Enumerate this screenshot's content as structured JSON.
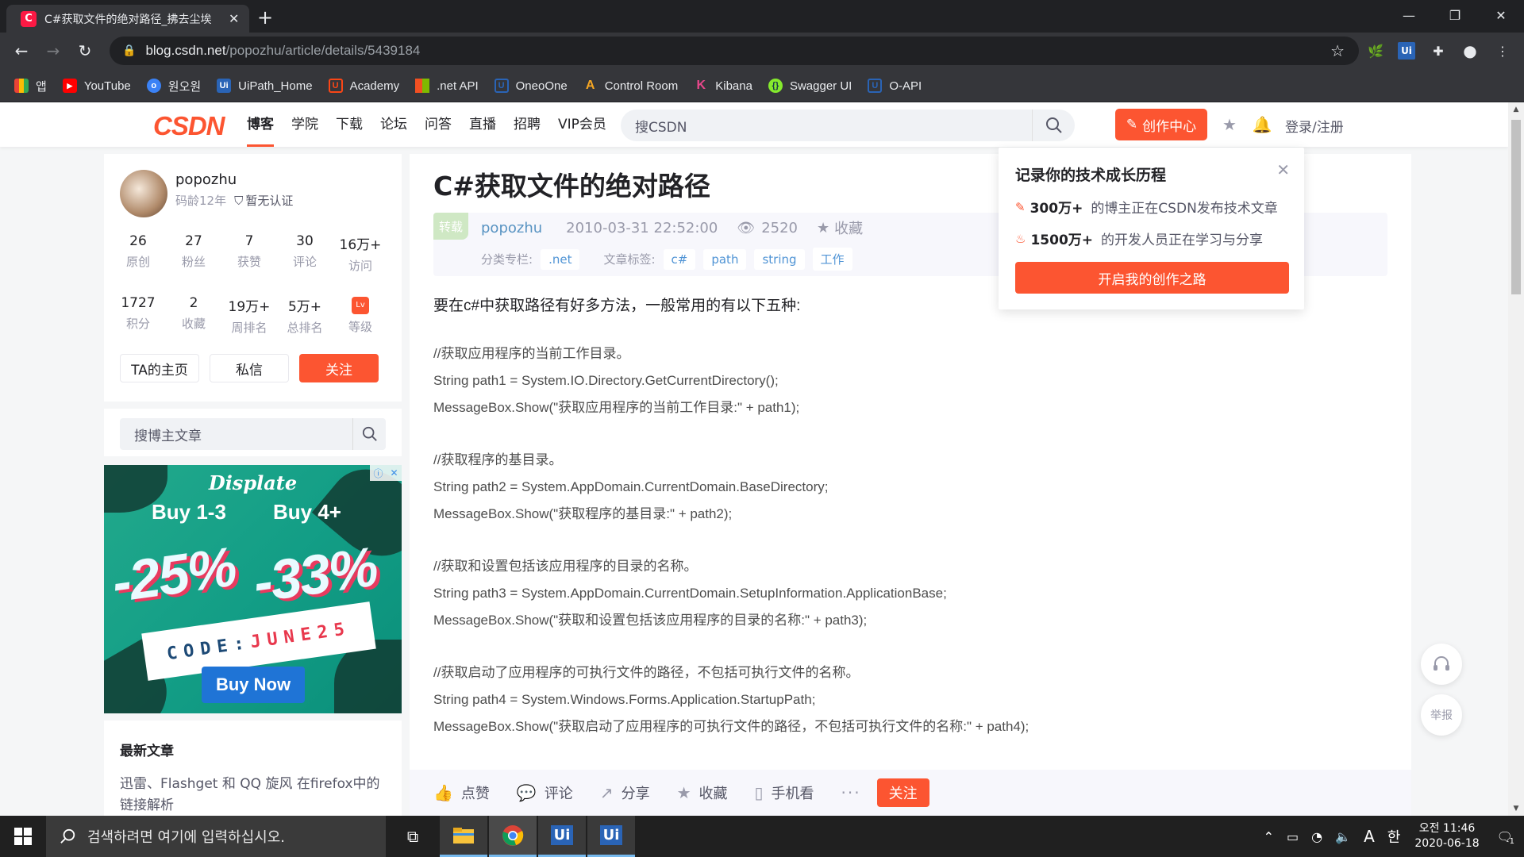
{
  "browser": {
    "tab_title": "C#获取文件的绝对路径_拂去尘埃",
    "favicon_letter": "C",
    "url_host": "blog.csdn.net",
    "url_path": "/popozhu/article/details/5439184",
    "bookmarks": [
      {
        "label": "앱",
        "icon": "apps-icon",
        "color": "#4285f4"
      },
      {
        "label": "YouTube",
        "icon": "youtube-icon",
        "color": "#ff0000"
      },
      {
        "label": "원오원",
        "icon": "wonone-icon",
        "color": "#3b82f6"
      },
      {
        "label": "UiPath_Home",
        "icon": "uipath-icon",
        "color": "#2a64b6"
      },
      {
        "label": "Academy",
        "icon": "uipath-academy-icon",
        "color": "#fa4616"
      },
      {
        "label": ".net API",
        "icon": "microsoft-icon",
        "color": "#f25022"
      },
      {
        "label": "OneoOne",
        "icon": "uipath-outline-icon",
        "color": "#2a64b6"
      },
      {
        "label": "Control Room",
        "icon": "automation-anywhere-icon",
        "color": "#f5a623"
      },
      {
        "label": "Kibana",
        "icon": "kibana-icon",
        "color": "#e8478b"
      },
      {
        "label": "Swagger UI",
        "icon": "swagger-icon",
        "color": "#85ea2d"
      },
      {
        "label": "O-API",
        "icon": "uipath-outline-icon",
        "color": "#2a64b6"
      }
    ]
  },
  "header": {
    "logo": "CSDN",
    "nav": [
      "博客",
      "学院",
      "下载",
      "论坛",
      "问答",
      "直播",
      "招聘",
      "VIP会员"
    ],
    "active_nav": "博客",
    "search_placeholder": "搜CSDN",
    "create_label": "创作中心",
    "login_label": "登录/注册"
  },
  "profile": {
    "name": "popozhu",
    "years": "码龄12年",
    "verify": "暂无认证",
    "stats_row1": [
      {
        "num": "26",
        "label": "原创"
      },
      {
        "num": "27",
        "label": "粉丝"
      },
      {
        "num": "7",
        "label": "获赞"
      },
      {
        "num": "30",
        "label": "评论"
      },
      {
        "num": "16万+",
        "label": "访问"
      }
    ],
    "stats_row2": [
      {
        "num": "1727",
        "label": "积分"
      },
      {
        "num": "2",
        "label": "收藏"
      },
      {
        "num": "19万+",
        "label": "周排名"
      },
      {
        "num": "5万+",
        "label": "总排名"
      },
      {
        "num": "",
        "label": "等级"
      }
    ],
    "btn_home": "TA的主页",
    "btn_message": "私信",
    "btn_follow": "关注"
  },
  "blog_search": {
    "placeholder": "搜博主文章"
  },
  "ad": {
    "brand": "Displate",
    "buy1": "Buy 1-3",
    "buy2": "Buy 4+",
    "pct1": "-25%",
    "pct2": "-33%",
    "code_prefix": "CODE:",
    "code": "JUNE25",
    "cta": "Buy Now"
  },
  "recent": {
    "title": "最新文章",
    "items": [
      "迅雷、Flashget 和 QQ 旋风 在firefox中的链接解析"
    ]
  },
  "article": {
    "title": "C#获取文件的绝对路径",
    "repost_badge": "转载",
    "author": "popozhu",
    "date": "2010-03-31 22:52:00",
    "views": "2520",
    "favorite": "收藏",
    "category_label": "分类专栏:",
    "category": ".net",
    "tags_label": "文章标签:",
    "tags": [
      "c#",
      "path",
      "string",
      "工作"
    ],
    "intro": "要在c#中获取路径有好多方法，一般常用的有以下五种:",
    "blocks": [
      [
        "//获取应用程序的当前工作目录。",
        "String path1 = System.IO.Directory.GetCurrentDirectory();",
        "MessageBox.Show(\"获取应用程序的当前工作目录:\" + path1);"
      ],
      [
        "//获取程序的基目录。",
        "String path2 = System.AppDomain.CurrentDomain.BaseDirectory;",
        "MessageBox.Show(\"获取程序的基目录:\" + path2);"
      ],
      [
        "//获取和设置包括该应用程序的目录的名称。",
        "String path3 = System.AppDomain.CurrentDomain.SetupInformation.ApplicationBase;",
        "MessageBox.Show(\"获取和设置包括该应用程序的目录的名称:\" + path3);"
      ],
      [
        "//获取启动了应用程序的可执行文件的路径，不包括可执行文件的名称。",
        "String path4 = System.Windows.Forms.Application.StartupPath;",
        "MessageBox.Show(\"获取启动了应用程序的可执行文件的路径，不包括可执行文件的名称:\" + path4);"
      ]
    ]
  },
  "actions": {
    "like": "点赞",
    "comment": "评论",
    "share": "分享",
    "favorite": "收藏",
    "mobile": "手机看",
    "more": "···",
    "follow": "关注"
  },
  "popover": {
    "title": "记录你的技术成长历程",
    "line1_num": "300万+",
    "line1_text": "的博主正在CSDN发布技术文章",
    "line2_num": "1500万+",
    "line2_text": "的开发人员正在学习与分享",
    "button": "开启我的创作之路"
  },
  "floating": {
    "report": "举报"
  },
  "taskbar": {
    "search_placeholder": "검색하려면 여기에 입력하십시오.",
    "time": "오전 11:46",
    "date": "2020-06-18",
    "ime": "한",
    "lang": "A",
    "notif_count": "1"
  }
}
